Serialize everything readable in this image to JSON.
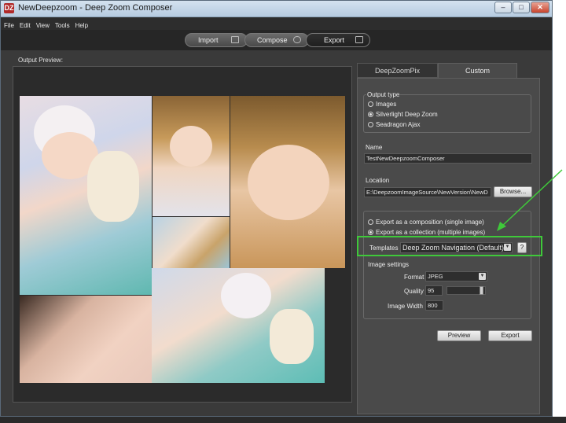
{
  "window": {
    "title": "NewDeepzoom - Deep Zoom Composer",
    "app_icon": "DZ"
  },
  "window_controls": {
    "minimize": "–",
    "maximize": "□",
    "close": "✕"
  },
  "menu": [
    "File",
    "Edit",
    "View",
    "Tools",
    "Help"
  ],
  "modes": {
    "import": "Import",
    "compose": "Compose",
    "export": "Export",
    "active": "Export"
  },
  "preview": {
    "label": "Output Preview:"
  },
  "tabs": {
    "deepzoompix": "DeepZoomPix",
    "custom": "Custom",
    "active": "Custom"
  },
  "output_type": {
    "legend": "Output type",
    "options": [
      "Images",
      "Silverlight Deep Zoom",
      "Seadragon Ajax"
    ],
    "selected": "Silverlight Deep Zoom"
  },
  "name": {
    "label": "Name",
    "value": "TestNewDeepzoomComposer"
  },
  "location": {
    "label": "Location",
    "value": "E:\\DeepzoomImageSource\\NewVersion\\NewD",
    "browse": "Browse..."
  },
  "export_mode": {
    "options": [
      "Export as a composition (single image)",
      "Export as a collection (multiple images)"
    ],
    "selected": "Export as a collection (multiple images)"
  },
  "templates": {
    "label": "Templates",
    "value": "Deep Zoom Navigation (Default)",
    "help": "?"
  },
  "image_settings": {
    "legend": "Image settings",
    "format_label": "Format",
    "format_value": "JPEG",
    "quality_label": "Quality",
    "quality_value": "95",
    "quality_fraction": 0.95,
    "width_label": "Image Width",
    "width_value": "800"
  },
  "buttons": {
    "preview": "Preview",
    "export": "Export"
  },
  "colors": {
    "highlight": "#3fc93a",
    "arrow": "#3fc93a",
    "panel": "#4a4a4a",
    "background": "#3a3a3a"
  }
}
